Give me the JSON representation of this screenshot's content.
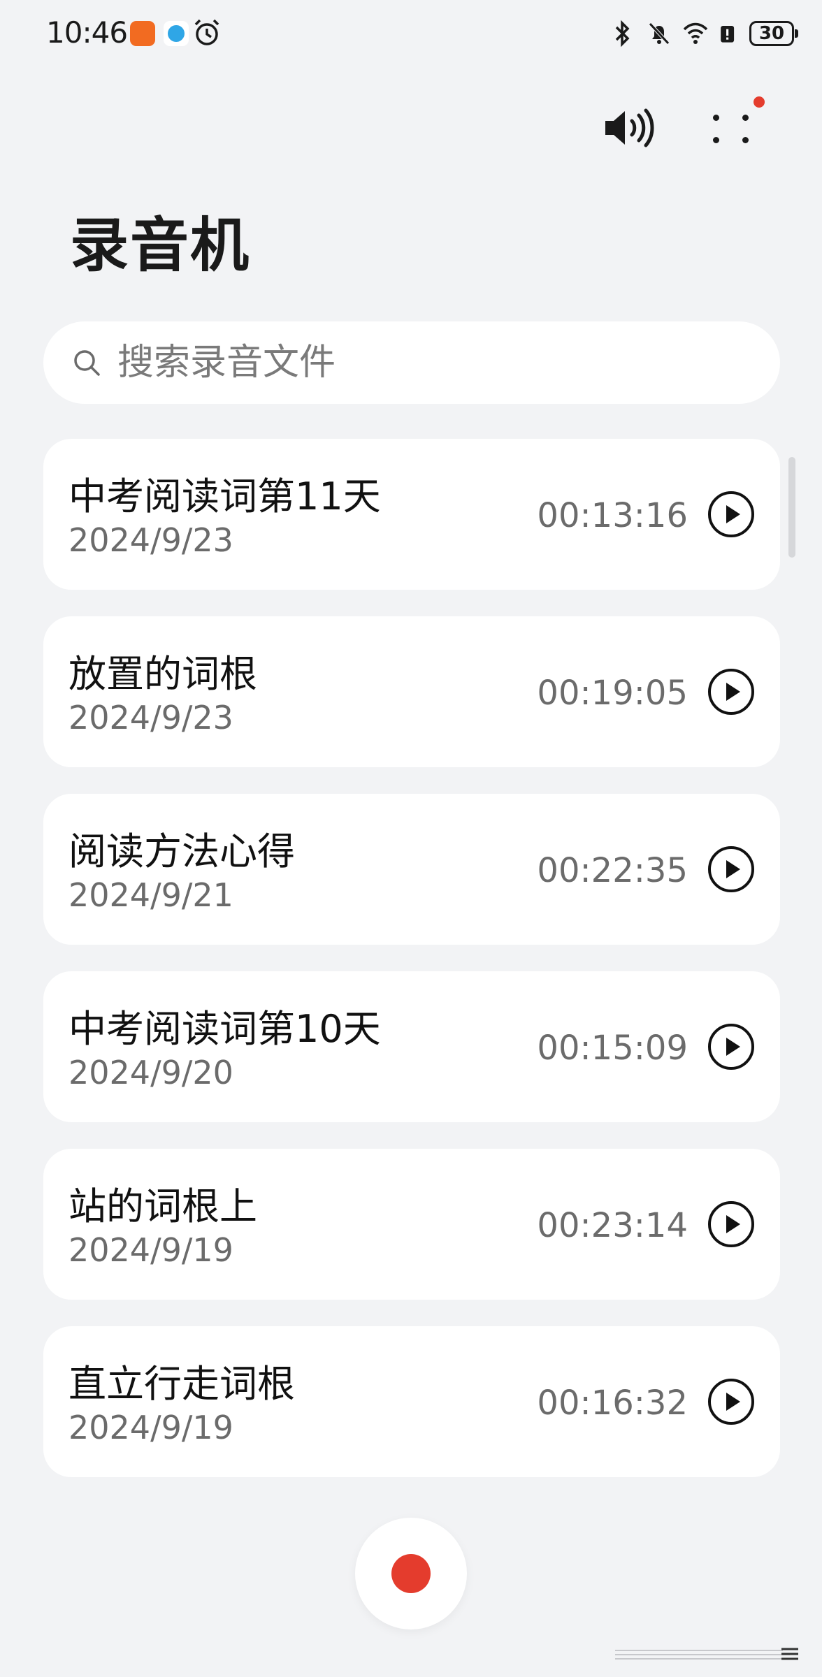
{
  "status_bar": {
    "time": "10:46",
    "battery_level": "30",
    "icons": [
      "bluetooth-icon",
      "mute-icon",
      "wifi-icon",
      "battery-saver-icon",
      "battery-icon"
    ]
  },
  "header": {
    "title": "录音机"
  },
  "search": {
    "placeholder": "搜索录音文件"
  },
  "recordings": [
    {
      "title": "中考阅读词第11天",
      "date": "2024/9/23",
      "duration": "00:13:16"
    },
    {
      "title": "放置的词根",
      "date": "2024/9/23",
      "duration": "00:19:05"
    },
    {
      "title": "阅读方法心得",
      "date": "2024/9/21",
      "duration": "00:22:35"
    },
    {
      "title": "中考阅读词第10天",
      "date": "2024/9/20",
      "duration": "00:15:09"
    },
    {
      "title": "站的词根上",
      "date": "2024/9/19",
      "duration": "00:23:14"
    },
    {
      "title": "直立行走词根",
      "date": "2024/9/19",
      "duration": "00:16:32"
    }
  ],
  "colors": {
    "background": "#f2f3f5",
    "card": "#ffffff",
    "record_accent": "#e43c2d",
    "secondary_text": "#6b6b6b"
  }
}
